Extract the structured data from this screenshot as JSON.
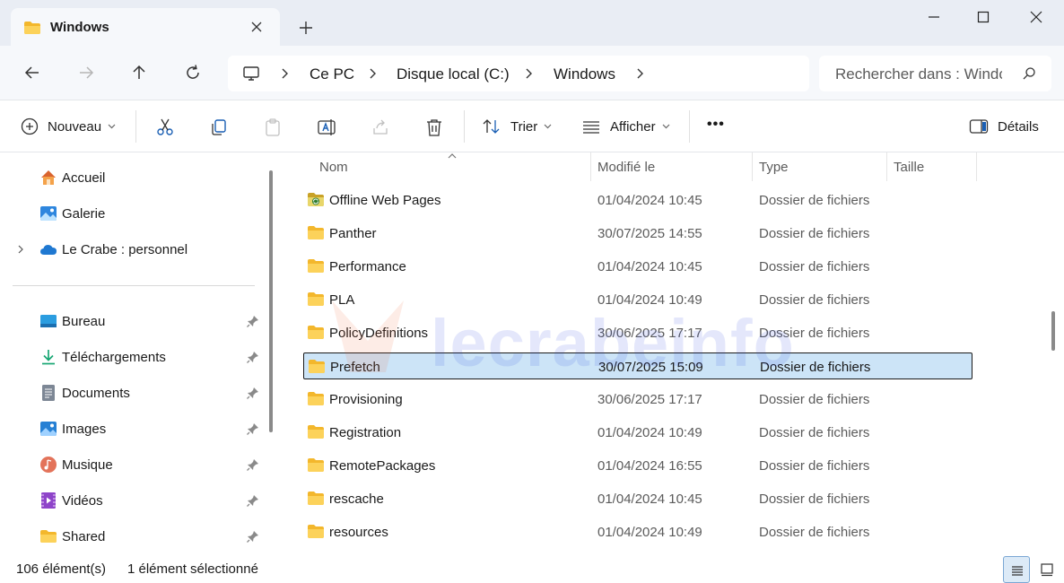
{
  "window": {
    "tab_title": "Windows",
    "new_tab": "+"
  },
  "address": {
    "crumbs": [
      "Ce PC",
      "Disque local (C:)",
      "Windows"
    ]
  },
  "search": {
    "placeholder": "Rechercher dans : Windows"
  },
  "toolbar": {
    "new_label": "Nouveau",
    "sort_label": "Trier",
    "view_label": "Afficher",
    "more_label": "•••",
    "details_label": "Détails"
  },
  "sidebar": {
    "top_items": [
      {
        "label": "Accueil",
        "icon": "home-icon"
      },
      {
        "label": "Galerie",
        "icon": "gallery-icon"
      },
      {
        "label": "Le Crabe : personnel",
        "icon": "onedrive-cloud-icon"
      }
    ],
    "pinned_items": [
      {
        "label": "Bureau",
        "icon": "desktop-icon"
      },
      {
        "label": "Téléchargements",
        "icon": "download-icon"
      },
      {
        "label": "Documents",
        "icon": "documents-icon"
      },
      {
        "label": "Images",
        "icon": "images-icon"
      },
      {
        "label": "Musique",
        "icon": "music-icon"
      },
      {
        "label": "Vidéos",
        "icon": "videos-icon"
      },
      {
        "label": "Shared",
        "icon": "folder-icon"
      }
    ]
  },
  "columns": {
    "name": "Nom",
    "modified": "Modifié le",
    "type": "Type",
    "size": "Taille"
  },
  "files": [
    {
      "name": "Offline Web Pages",
      "date": "01/04/2024 10:45",
      "type": "Dossier de fichiers",
      "special": true
    },
    {
      "name": "Panther",
      "date": "30/07/2025 14:55",
      "type": "Dossier de fichiers"
    },
    {
      "name": "Performance",
      "date": "01/04/2024 10:45",
      "type": "Dossier de fichiers"
    },
    {
      "name": "PLA",
      "date": "01/04/2024 10:49",
      "type": "Dossier de fichiers"
    },
    {
      "name": "PolicyDefinitions",
      "date": "30/06/2025 17:17",
      "type": "Dossier de fichiers"
    },
    {
      "name": "Prefetch",
      "date": "30/07/2025 15:09",
      "type": "Dossier de fichiers",
      "selected": true
    },
    {
      "name": "Provisioning",
      "date": "30/06/2025 17:17",
      "type": "Dossier de fichiers"
    },
    {
      "name": "Registration",
      "date": "01/04/2024 10:49",
      "type": "Dossier de fichiers"
    },
    {
      "name": "RemotePackages",
      "date": "01/04/2024 16:55",
      "type": "Dossier de fichiers"
    },
    {
      "name": "rescache",
      "date": "01/04/2024 10:45",
      "type": "Dossier de fichiers"
    },
    {
      "name": "resources",
      "date": "01/04/2024 10:49",
      "type": "Dossier de fichiers"
    }
  ],
  "watermark": {
    "text": "lecrabeinfo"
  },
  "status": {
    "count": "106 élément(s)",
    "selection": "1 élément sélectionné"
  },
  "colors": {
    "accent": "#0067c0",
    "selection": "#cce4f7",
    "folder": "#f8c33a"
  }
}
